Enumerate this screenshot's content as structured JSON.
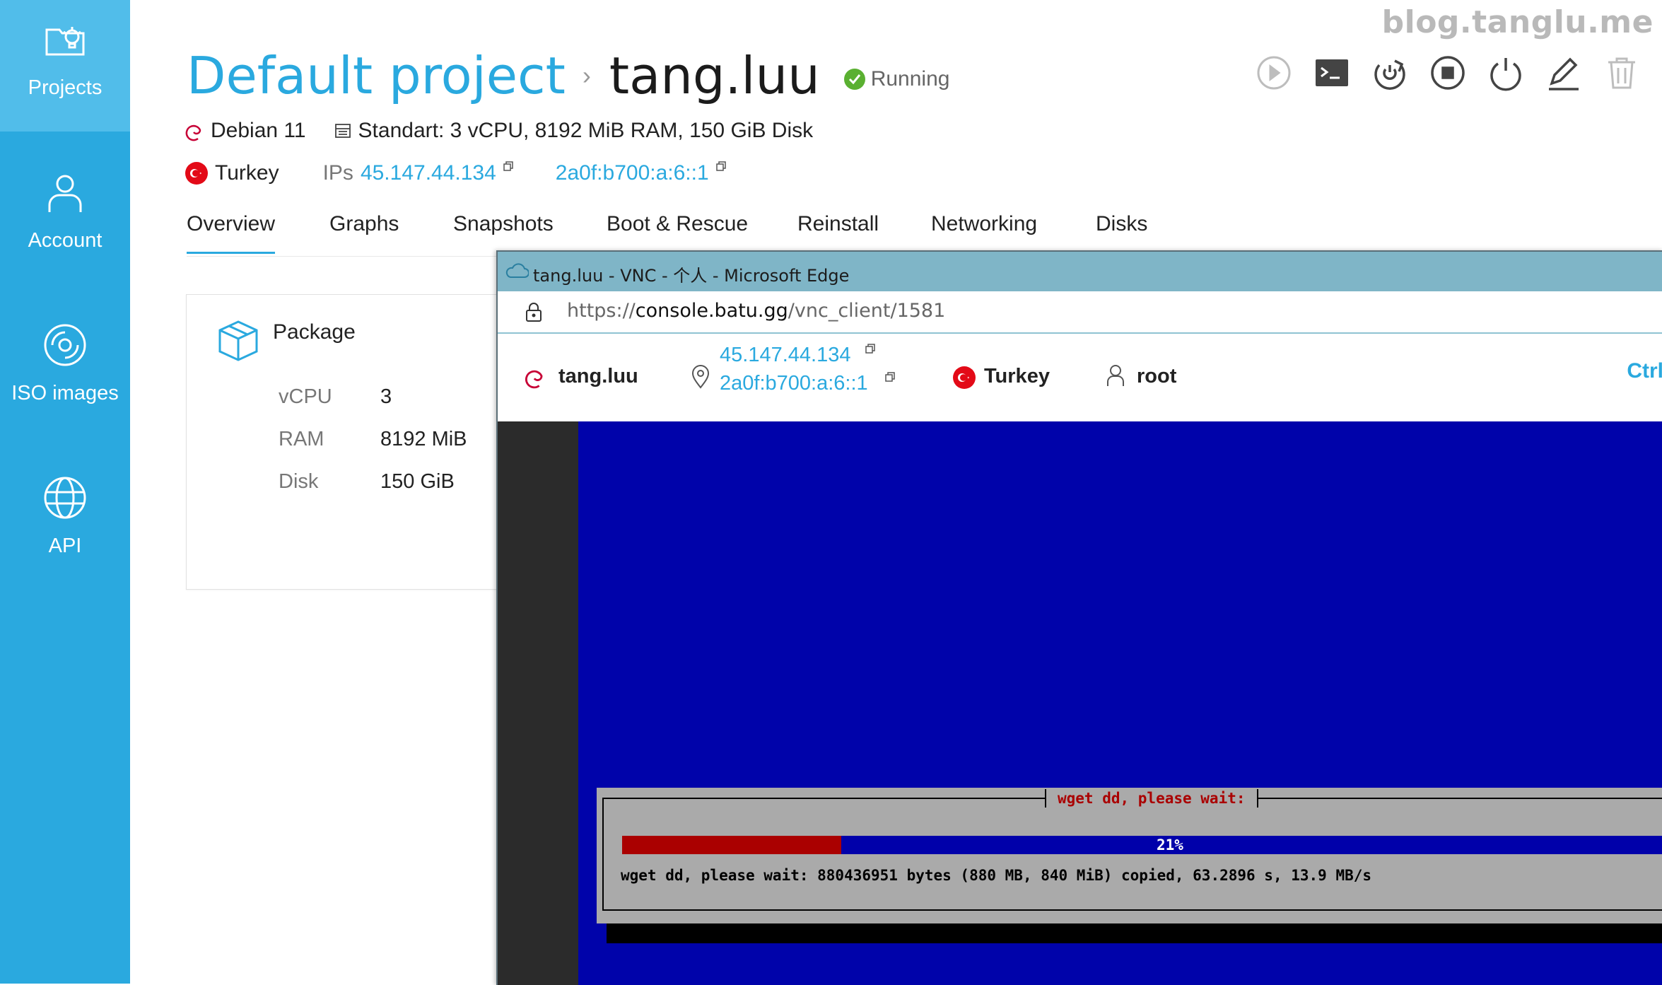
{
  "watermark": "blog.tanglu.me",
  "sidebar": {
    "items": [
      {
        "label": "Projects",
        "icon": "projects-icon",
        "active": true
      },
      {
        "label": "Account",
        "icon": "user-icon",
        "active": false
      },
      {
        "label": "ISO images",
        "icon": "disc-icon",
        "active": false
      },
      {
        "label": "API",
        "icon": "globe-icon",
        "active": false
      }
    ]
  },
  "header": {
    "project": "Default project",
    "separator": "›",
    "server_name": "tang.luu",
    "status": "Running",
    "os": "Debian 11",
    "plan": "Standart: 3 vCPU, 8192 MiB RAM, 150 GiB Disk",
    "location": "Turkey",
    "ips_label": "IPs",
    "ipv4": "45.147.44.134",
    "ipv6": "2a0f:b700:a:6::1",
    "actions": [
      "play-icon",
      "console-icon",
      "restart-icon",
      "stop-icon",
      "power-icon",
      "edit-icon",
      "trash-icon"
    ]
  },
  "tabs": [
    "Overview",
    "Graphs",
    "Snapshots",
    "Boot & Rescue",
    "Reinstall",
    "Networking",
    "Disks"
  ],
  "package": {
    "title": "Package",
    "rows": [
      {
        "key": "vCPU",
        "value": "3"
      },
      {
        "key": "RAM",
        "value": "8192 MiB"
      },
      {
        "key": "Disk",
        "value": "150 GiB"
      }
    ]
  },
  "edge": {
    "title": "tang.luu - VNC - 个人 - Microsoft Edge",
    "url_scheme": "https://",
    "url_host": "console.batu.gg",
    "url_path": "/vnc_client/1581",
    "vnc": {
      "server": "tang.luu",
      "ipv4": "45.147.44.134",
      "ipv6": "2a0f:b700:a:6::1",
      "location": "Turkey",
      "user": "root",
      "ctrl": "Ctrl"
    },
    "console": {
      "dialog_title": "wget dd, please wait:",
      "progress_percent": 21,
      "progress_label": "21%",
      "status_line": "wget dd, please wait: 880436951 bytes (880 MB, 840 MiB) copied, 63.2896 s, 13.9 MB/s"
    }
  },
  "colors": {
    "accent": "#2aa9df",
    "sidebar": "#2aa9df",
    "running": "#5ab031",
    "turkey_flag": "#e30a17",
    "debian": "#c70036",
    "vnc_blue": "#0003aa",
    "progress_red": "#aa0000"
  }
}
